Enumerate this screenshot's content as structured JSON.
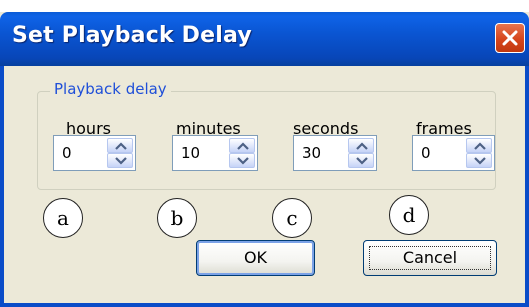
{
  "window": {
    "title": "Set Playback Delay"
  },
  "group": {
    "label": "Playback delay"
  },
  "fields": [
    {
      "label": "hours",
      "value": "0",
      "marker": "a"
    },
    {
      "label": "minutes",
      "value": "10",
      "marker": "b"
    },
    {
      "label": "seconds",
      "value": "30",
      "marker": "c"
    },
    {
      "label": "frames",
      "value": "0",
      "marker": "d"
    }
  ],
  "buttons": {
    "ok": "OK",
    "cancel": "Cancel"
  },
  "icons": {
    "close": "close-icon",
    "up": "arrow-up-icon",
    "down": "arrow-down-icon"
  },
  "colors": {
    "titlebar": "#0a55d2",
    "close": "#d6451c",
    "group_label": "#1f4fd8",
    "dialog_bg": "#ece9d8"
  }
}
